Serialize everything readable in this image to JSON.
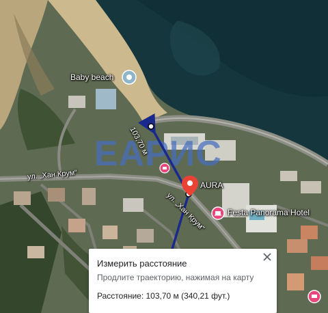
{
  "map": {
    "places": {
      "baby_beach": "Baby beach",
      "aura": "AURA",
      "festa": "Festa Panorama Hotel"
    },
    "streets": {
      "khan_krum_1": "ул. „Хан Крум“",
      "khan_krum_2": "ул. „Хан Крум“"
    },
    "measure_label": "103,70 м",
    "logo_text": "ЕАРИС",
    "colors": {
      "sea": "#13343a",
      "sand": "#c9b68c",
      "measure_line": "#1a2a8c",
      "aura_pin": "#ea4335",
      "hotel_pin": "#e8467c",
      "beach_pin": "#8ab4c8"
    }
  },
  "measure_panel": {
    "title": "Измерить расстояние",
    "hint": "Продлите траекторию, нажимая на карту",
    "result": "Расстояние: 103,70 м (340,21 фут.)"
  }
}
